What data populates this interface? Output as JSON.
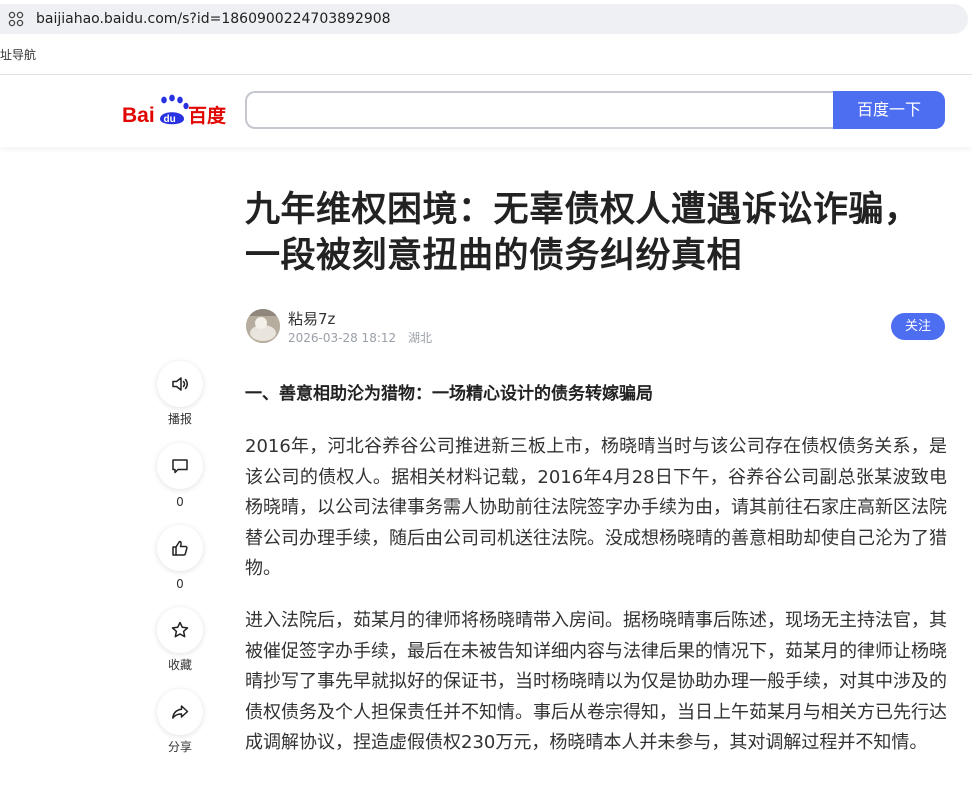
{
  "browser": {
    "url": "baijiahao.baidu.com/s?id=1860900224703892908",
    "bookmark": "址导航"
  },
  "header": {
    "search_placeholder": "",
    "search_button": "百度一下",
    "brand_colors": {
      "red": "#e10601",
      "blue": "#2932e1",
      "button": "#4e6ef2"
    }
  },
  "article": {
    "title": "九年维权困境：无辜债权人遭遇诉讼诈骗，一段被刻意扭曲的债务纠纷真相",
    "author": "粘易7z",
    "date": "2026-03-28 18:12",
    "location": "湖北",
    "follow_label": "关注",
    "section_heading": "一、善意相助沦为猎物：一场精心设计的债务转嫁骗局",
    "paragraphs": [
      "2016年，河北谷养谷公司推进新三板上市，杨晓晴当时与该公司存在债权债务关系，是该公司的债权人。据相关材料记载，2016年4月28日下午，谷养谷公司副总张某波致电杨晓晴，以公司法律事务需人协助前往法院签字办手续为由，请其前往石家庄高新区法院替公司办理手续，随后由公司司机送往法院。没成想杨晓晴的善意相助却使自己沦为了猎物。",
      "进入法院后，茹某月的律师将杨晓晴带入房间。据杨晓晴事后陈述，现场无主持法官，其被催促签字办手续，最后在未被告知详细内容与法律后果的情况下，茹某月的律师让杨晓晴抄写了事先早就拟好的保证书，当时杨晓晴以为仅是协助办理一般手续，对其中涉及的债权债务及个人担保责任并不知情。事后从卷宗得知，当日上午茹某月与相关方已先行达成调解协议，捏造虚假债权230万元，杨晓晴本人并未参与，其对调解过程并不知情。"
    ]
  },
  "actions": [
    {
      "name": "listen",
      "icon": "speaker-icon",
      "label": "播报"
    },
    {
      "name": "comment",
      "icon": "comment-icon",
      "label": "0"
    },
    {
      "name": "like",
      "icon": "thumbs-up-icon",
      "label": "0"
    },
    {
      "name": "favorite",
      "icon": "star-icon",
      "label": "收藏"
    },
    {
      "name": "share",
      "icon": "share-icon",
      "label": "分享"
    }
  ]
}
